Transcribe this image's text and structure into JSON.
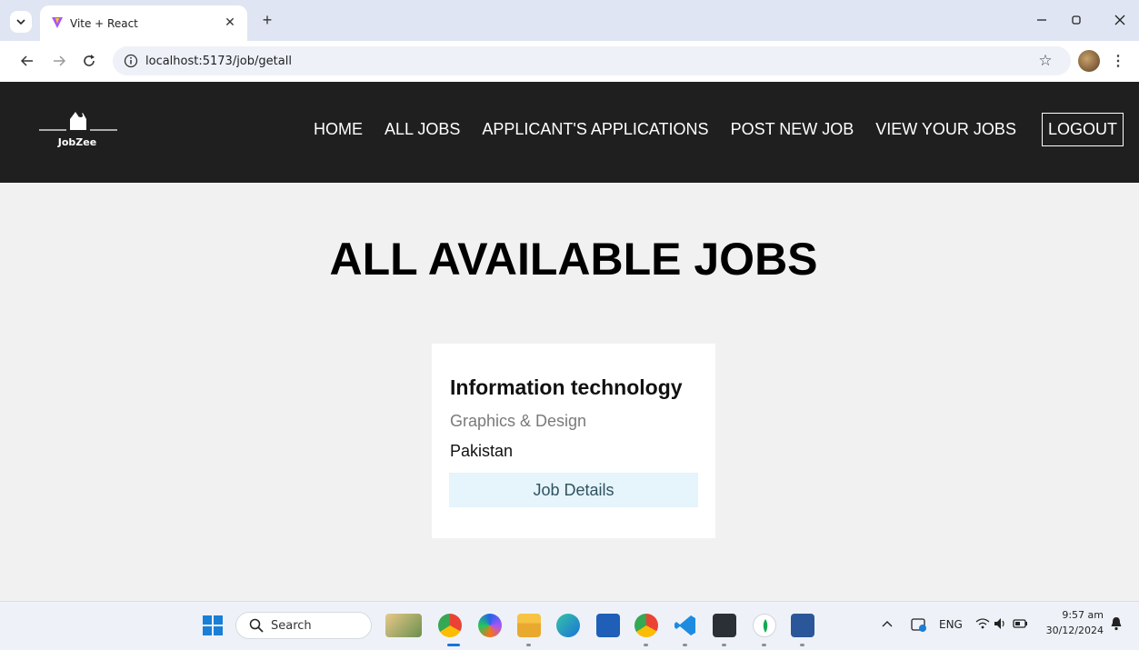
{
  "browser": {
    "tab_title": "Vite + React",
    "url": "localhost:5173/job/getall",
    "window_controls": [
      "–",
      "⬚",
      "✕"
    ]
  },
  "app": {
    "logo_text": "JobZee",
    "nav": [
      "HOME",
      "ALL JOBS",
      "APPLICANT'S APPLICATIONS",
      "POST NEW JOB",
      "VIEW YOUR JOBS"
    ],
    "logout_label": "LOGOUT"
  },
  "main": {
    "title": "ALL AVAILABLE JOBS",
    "jobs": [
      {
        "title": "Information technology",
        "category": "Graphics & Design",
        "country": "Pakistan",
        "details_label": "Job Details"
      }
    ]
  },
  "taskbar": {
    "search_label": "Search",
    "language": "ENG",
    "time": "9:57 am",
    "date": "30/12/2024"
  },
  "colors": {
    "nav_bg": "#1f1f1f",
    "main_bg": "#f1f1f1",
    "button_bg": "#e6f4fb",
    "tabstrip_bg": "#dfe5f2"
  }
}
